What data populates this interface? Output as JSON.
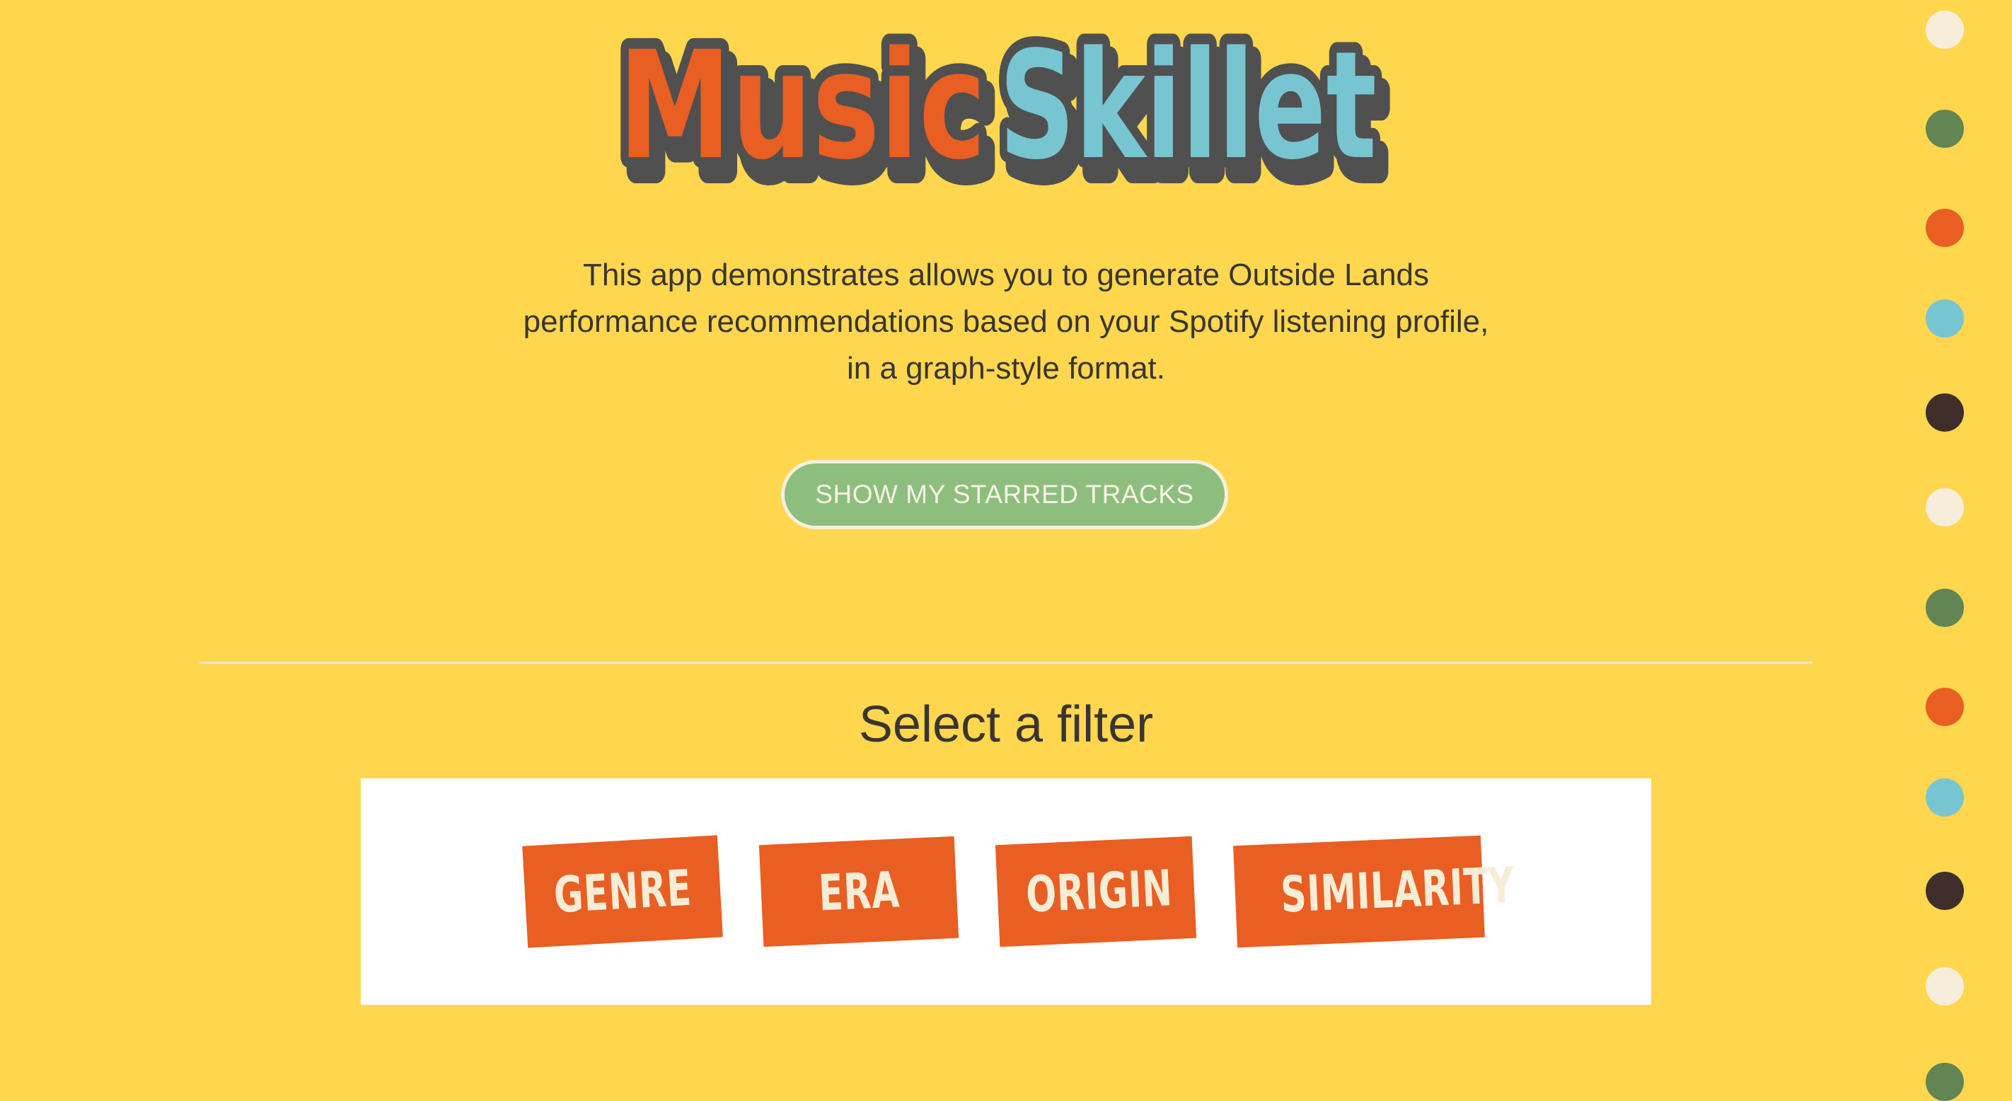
{
  "logo": {
    "word1": "Music",
    "word2": "Skillet",
    "colors": {
      "word1": "#E95E22",
      "word2": "#78C5D2",
      "outline": "#505050"
    }
  },
  "intro": {
    "line1": "This app demonstrates allows you to generate Outside Lands",
    "line2": "performance recommendations based on your Spotify listening profile,",
    "line3": "in a graph-style format."
  },
  "starred_button": {
    "label": "SHOW MY STARRED TRACKS"
  },
  "filter": {
    "heading": "Select a filter",
    "options": [
      "GENRE",
      "ERA",
      "ORIGIN",
      "SIMILARITY"
    ]
  },
  "colors": {
    "background": "#FED74F",
    "accent_orange": "#E95E22",
    "button_green": "#8DBE7D",
    "text_dark": "#3A3530"
  },
  "side_dots": [
    "#F6EEDA",
    "#638453",
    "#E95E22",
    "#78C5D2",
    "#3F2E29",
    "#F6EEDA",
    "#638453",
    "#E95E22",
    "#78C5D2",
    "#3F2E29",
    "#F6EEDA",
    "#638453"
  ]
}
